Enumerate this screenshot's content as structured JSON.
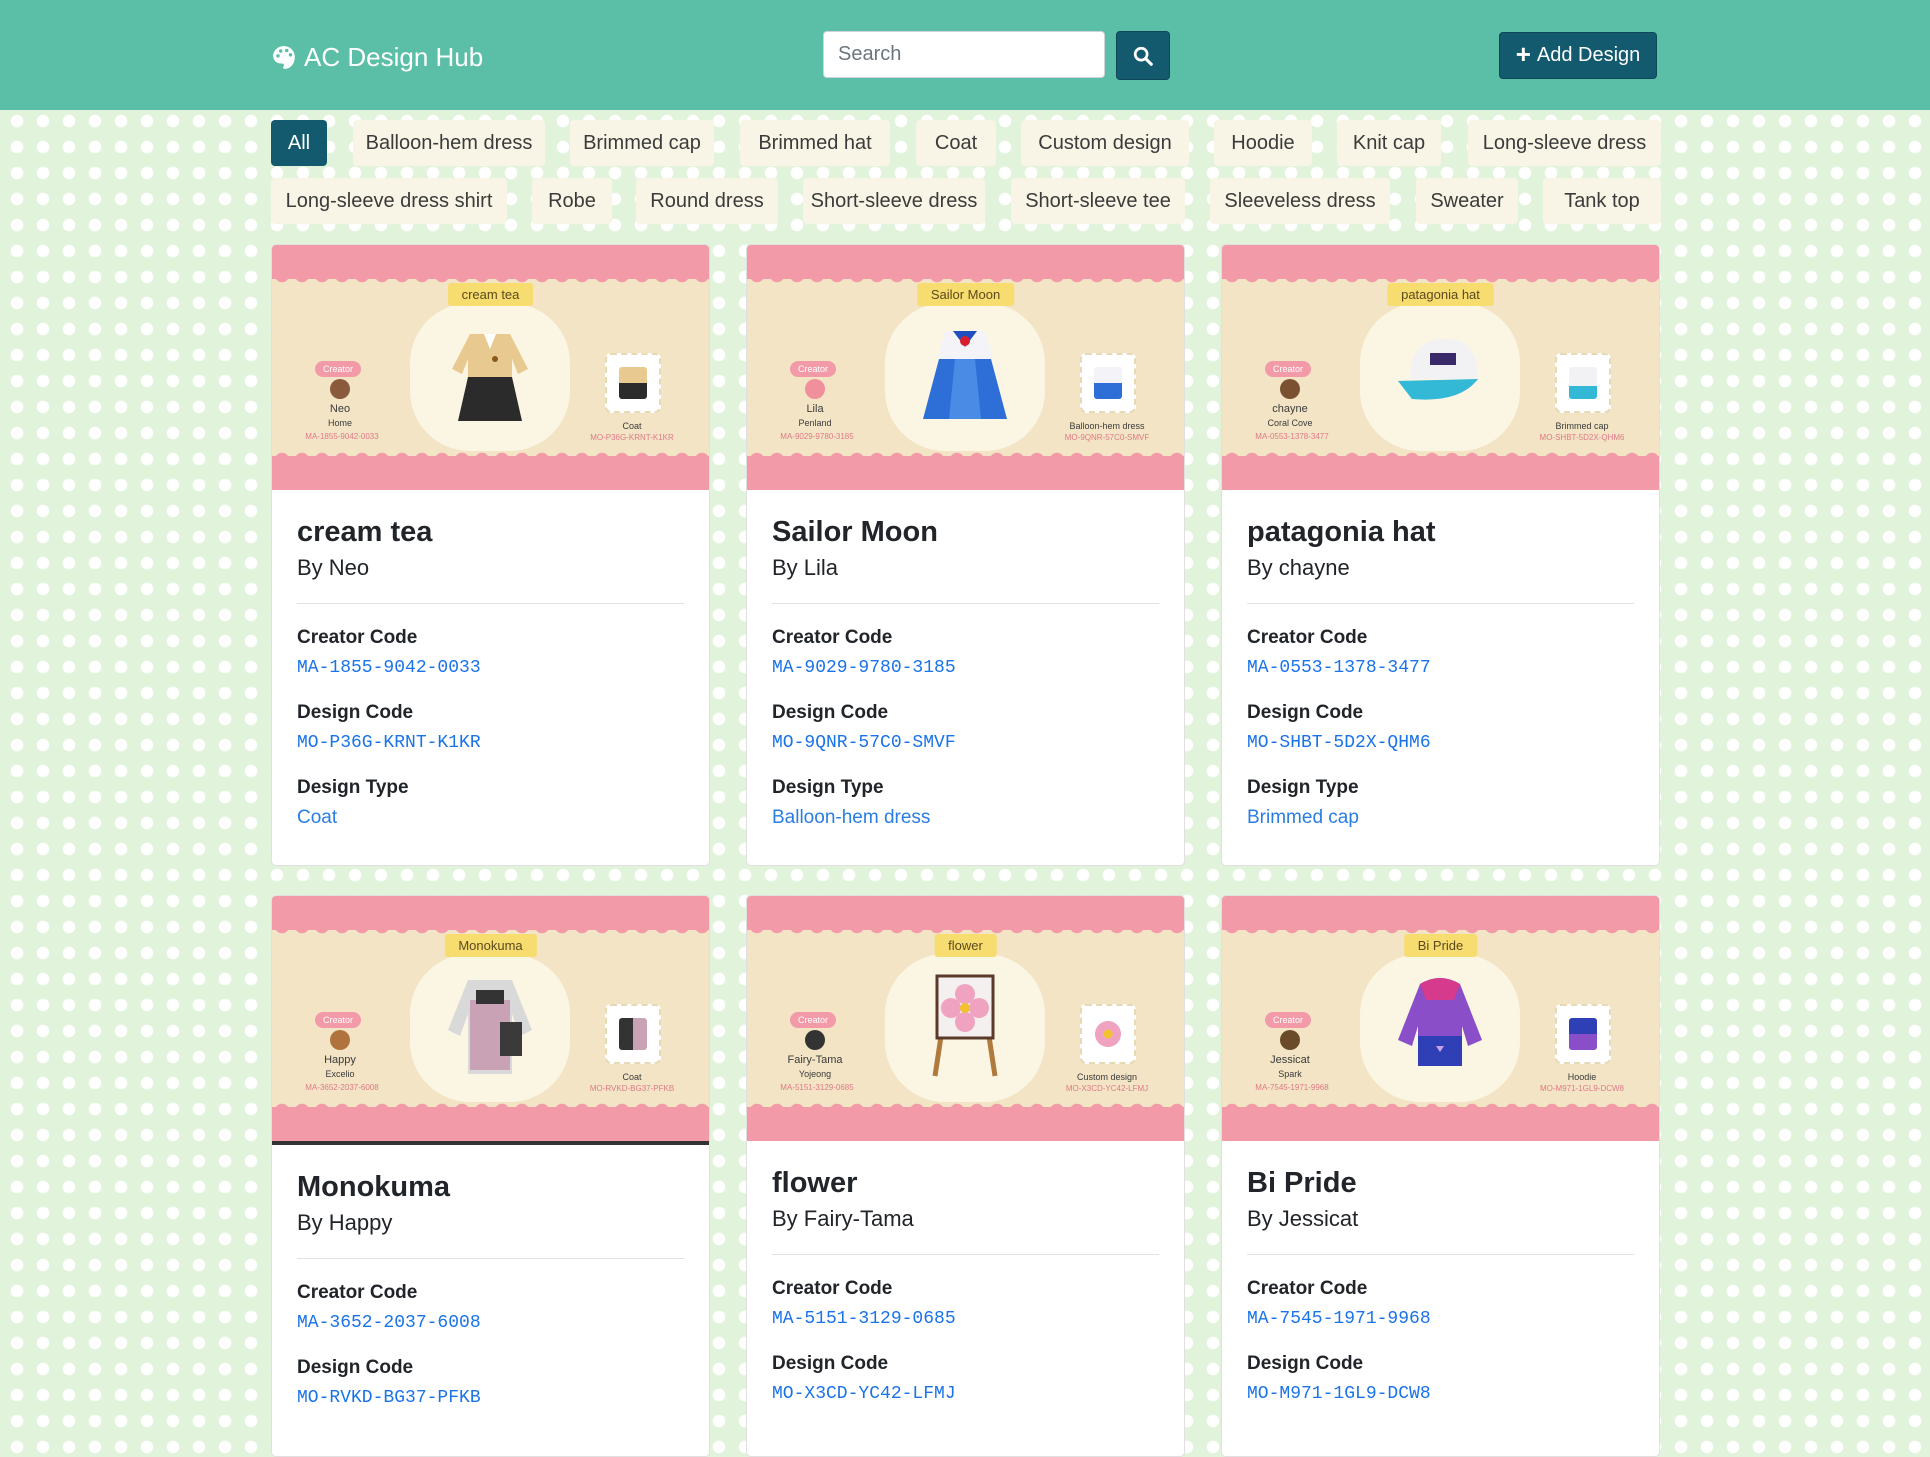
{
  "nav": {
    "brand": "AC Design Hub",
    "search_placeholder": "Search",
    "add_label": "Add Design"
  },
  "filters": [
    "All",
    "Balloon-hem dress",
    "Brimmed cap",
    "Brimmed hat",
    "Coat",
    "Custom design",
    "Hoodie",
    "Knit cap",
    "Long-sleeve dress",
    "Long-sleeve dress shirt",
    "Robe",
    "Round dress",
    "Short-sleeve dress",
    "Short-sleeve tee",
    "Sleeveless dress",
    "Sweater",
    "Tank top"
  ],
  "labels": {
    "creator_code": "Creator Code",
    "design_code": "Design Code",
    "design_type": "Design Type"
  },
  "cards": [
    {
      "title": "cream tea",
      "by": "By Neo",
      "creator_code": "MA-1855-9042-0033",
      "design_code": "MO-P36G-KRNT-K1KR",
      "design_type": "Coat",
      "thumb": {
        "banner": "cream tea",
        "creator": "Creator",
        "name": "Neo",
        "island": "Home",
        "left_code": "MA-1855-9042-0033",
        "type": "Coat",
        "right_code": "MO-P36G-KRNT-K1KR"
      }
    },
    {
      "title": "Sailor Moon",
      "by": "By Lila",
      "creator_code": "MA-9029-9780-3185",
      "design_code": "MO-9QNR-57C0-SMVF",
      "design_type": "Balloon-hem dress",
      "thumb": {
        "banner": "Sailor Moon",
        "creator": "Creator",
        "name": "Lila",
        "island": "Penland",
        "left_code": "MA-9029-9780-3185",
        "type": "Balloon-hem dress",
        "right_code": "MO-9QNR-57C0-SMVF"
      }
    },
    {
      "title": "patagonia hat",
      "by": "By chayne",
      "creator_code": "MA-0553-1378-3477",
      "design_code": "MO-SHBT-5D2X-QHM6",
      "design_type": "Brimmed cap",
      "thumb": {
        "banner": "patagonia hat",
        "creator": "Creator",
        "name": "chayne",
        "island": "Coral Cove",
        "left_code": "MA-0553-1378-3477",
        "type": "Brimmed cap",
        "right_code": "MO-SHBT-5D2X-QHM6"
      }
    },
    {
      "title": "Monokuma",
      "by": "By Happy",
      "creator_code": "MA-3652-2037-6008",
      "design_code": "MO-RVKD-BG37-PFKB",
      "design_type": "",
      "thumb": {
        "banner": "Monokuma",
        "creator": "Creator",
        "name": "Happy",
        "island": "Excelio",
        "left_code": "MA-3652-2037-6008",
        "type": "Coat",
        "right_code": "MO-RVKD-BG37-PFKB"
      }
    },
    {
      "title": "flower",
      "by": "By Fairy-Tama",
      "creator_code": "MA-5151-3129-0685",
      "design_code": "MO-X3CD-YC42-LFMJ",
      "design_type": "",
      "thumb": {
        "banner": "flower",
        "creator": "Creator",
        "name": "Fairy-Tama",
        "island": "Yojeong",
        "left_code": "MA-5151-3129-0685",
        "type": "Custom design",
        "right_code": "MO-X3CD-YC42-LFMJ"
      }
    },
    {
      "title": "Bi Pride",
      "by": "By Jessicat",
      "creator_code": "MA-7545-1971-9968",
      "design_code": "MO-M971-1GL9-DCW8",
      "design_type": "",
      "thumb": {
        "banner": "Bi Pride",
        "creator": "Creator",
        "name": "Jessicat",
        "island": "Spark",
        "left_code": "MA-7545-1971-9968",
        "type": "Hoodie",
        "right_code": "MO-M971-1GL9-DCW8"
      }
    }
  ],
  "colors": {
    "navbar": "#5bbfa8",
    "button": "#135a6e",
    "chip": "#f8f5e6",
    "link": "#1a73e8",
    "page_bg": "#e2f3dc"
  }
}
